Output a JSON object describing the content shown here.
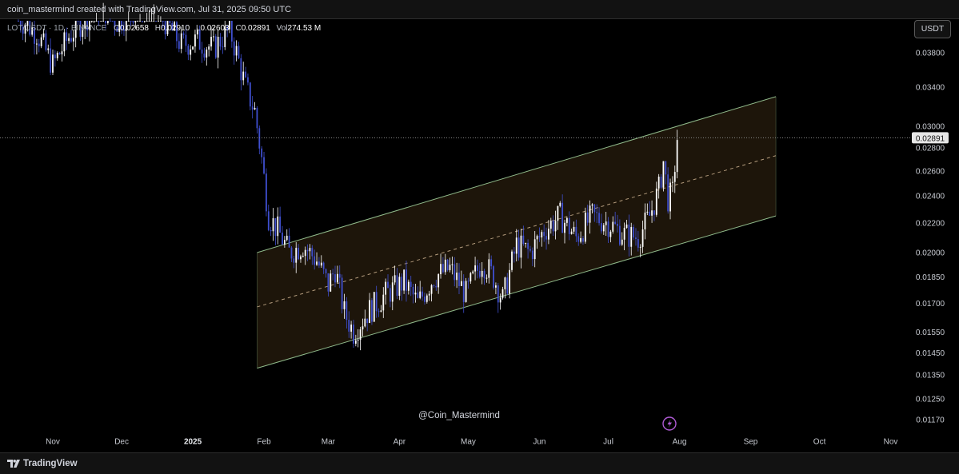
{
  "caption": "coin_mastermind created with TradingView.com, Jul 31, 2025 09:50 UTC",
  "legend": {
    "symbol": "LOT/USDT · 1D · BINANCE",
    "open_label": "O",
    "open": "0.02658",
    "high_label": "H",
    "high": "0.02910",
    "low_label": "L",
    "low": "0.02603",
    "close_label": "C",
    "close": "0.02891",
    "vol_label": "Vol",
    "vol": "274.53 M"
  },
  "currency_button": "USDT",
  "watermark": "@Coin_Mastermind",
  "brand": "TradingView",
  "colors": {
    "up_candle": "#ffffff",
    "down_candle": "#3f4fd0",
    "channel_line": "#8fb98a",
    "channel_fill": "#1f160b",
    "midline": "#b39b7c",
    "price_line": "#8a8a8a",
    "flash_icon": "#b05bd6"
  },
  "chart_data": {
    "type": "candlestick",
    "symbol": "LOT/USDT",
    "interval": "1D",
    "exchange": "BINANCE",
    "y_axis": {
      "scale": "log",
      "ticks": [
        "0.03800",
        "0.03400",
        "0.03000",
        "0.02800",
        "0.02600",
        "0.02400",
        "0.02200",
        "0.02000",
        "0.01850",
        "0.01700",
        "0.01550",
        "0.01450",
        "0.01350",
        "0.01250",
        "0.01170"
      ]
    },
    "x_axis": {
      "ticks": [
        {
          "label": "Nov",
          "bold": false
        },
        {
          "label": "Dec",
          "bold": false
        },
        {
          "label": "2025",
          "bold": true
        },
        {
          "label": "Feb",
          "bold": false
        },
        {
          "label": "Mar",
          "bold": false
        },
        {
          "label": "Apr",
          "bold": false
        },
        {
          "label": "May",
          "bold": false
        },
        {
          "label": "Jun",
          "bold": false
        },
        {
          "label": "Jul",
          "bold": false
        },
        {
          "label": "Aug",
          "bold": false
        },
        {
          "label": "Sep",
          "bold": false
        },
        {
          "label": "Oct",
          "bold": false
        },
        {
          "label": "Nov",
          "bold": false
        }
      ]
    },
    "last_price": "0.02891",
    "channel": {
      "start_date": "2025-01-29",
      "end_date": "2025-09-12",
      "upper": [
        0.02,
        0.033
      ],
      "lower": [
        0.0138,
        0.0225
      ],
      "middle": [
        0.0168,
        0.0273
      ]
    },
    "path": [
      [
        "2024-10-17",
        0.0425
      ],
      [
        "2024-10-25",
        0.0405
      ],
      [
        "2024-11-01",
        0.0365
      ],
      [
        "2024-11-08",
        0.04
      ],
      [
        "2024-11-15",
        0.0425
      ],
      [
        "2024-11-22",
        0.044
      ],
      [
        "2024-11-29",
        0.042
      ],
      [
        "2024-12-06",
        0.0435
      ],
      [
        "2024-12-13",
        0.045
      ],
      [
        "2024-12-20",
        0.042
      ],
      [
        "2024-12-27",
        0.039
      ],
      [
        "2025-01-03",
        0.0395
      ],
      [
        "2025-01-10",
        0.0385
      ],
      [
        "2025-01-17",
        0.041
      ],
      [
        "2025-01-20",
        0.038
      ],
      [
        "2025-01-24",
        0.034
      ],
      [
        "2025-01-28",
        0.0315
      ],
      [
        "2025-01-31",
        0.027
      ],
      [
        "2025-02-03",
        0.0225
      ],
      [
        "2025-02-07",
        0.0215
      ],
      [
        "2025-02-12",
        0.02
      ],
      [
        "2025-02-18",
        0.0205
      ],
      [
        "2025-02-24",
        0.0195
      ],
      [
        "2025-03-01",
        0.018
      ],
      [
        "2025-03-04",
        0.019
      ],
      [
        "2025-03-08",
        0.0165
      ],
      [
        "2025-03-12",
        0.0155
      ],
      [
        "2025-03-18",
        0.0165
      ],
      [
        "2025-03-26",
        0.0175
      ],
      [
        "2025-04-03",
        0.0182
      ],
      [
        "2025-04-09",
        0.017
      ],
      [
        "2025-04-16",
        0.0185
      ],
      [
        "2025-04-23",
        0.019
      ],
      [
        "2025-04-30",
        0.0175
      ],
      [
        "2025-05-07",
        0.0195
      ],
      [
        "2025-05-12",
        0.0185
      ],
      [
        "2025-05-16",
        0.0172
      ],
      [
        "2025-05-22",
        0.0205
      ],
      [
        "2025-05-28",
        0.02
      ],
      [
        "2025-06-03",
        0.0215
      ],
      [
        "2025-06-10",
        0.0225
      ],
      [
        "2025-06-17",
        0.021
      ],
      [
        "2025-06-24",
        0.0225
      ],
      [
        "2025-07-01",
        0.022
      ],
      [
        "2025-07-08",
        0.0212
      ],
      [
        "2025-07-14",
        0.021
      ],
      [
        "2025-07-19",
        0.0225
      ],
      [
        "2025-07-23",
        0.0245
      ],
      [
        "2025-07-25",
        0.0268
      ],
      [
        "2025-07-27",
        0.0238
      ],
      [
        "2025-07-29",
        0.0242
      ],
      [
        "2025-07-30",
        0.0265
      ],
      [
        "2025-07-31",
        0.0289
      ]
    ]
  }
}
